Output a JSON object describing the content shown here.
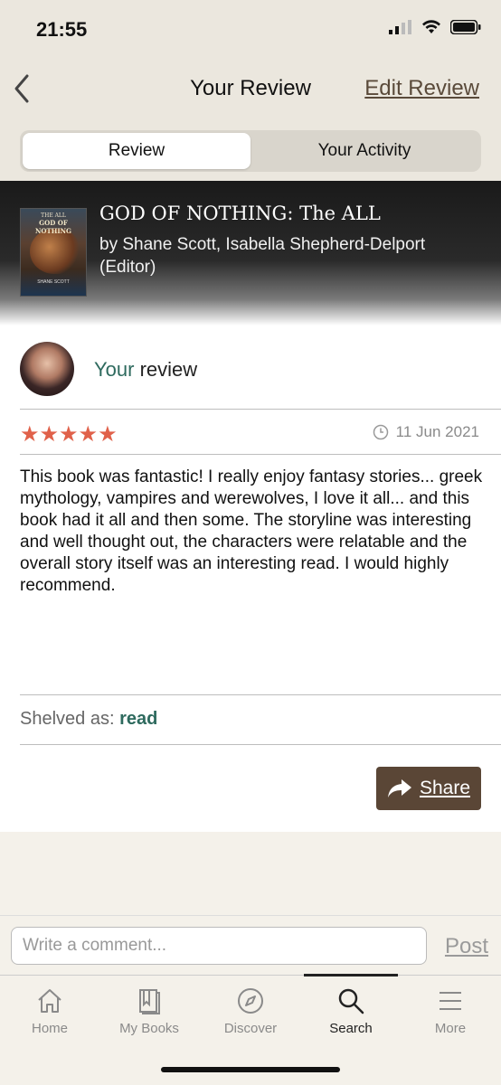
{
  "status_bar": {
    "time": "21:55"
  },
  "nav": {
    "title": "Your Review",
    "edit_label": "Edit Review",
    "tabs": [
      {
        "label": "Review",
        "active": true
      },
      {
        "label": "Your Activity",
        "active": false
      }
    ]
  },
  "book": {
    "title": "GOD OF NOTHING: The ALL",
    "authors": "by Shane Scott, Isabella Shepherd-Delport (Editor)",
    "cover": {
      "top_text": "THE ALL",
      "title": "GOD OF NOTHING",
      "author": "SHANE SCOTT"
    }
  },
  "review": {
    "label_accent": "Your",
    "label_rest": " review",
    "stars": "★★★★★",
    "rating": 5,
    "date": "11 Jun 2021",
    "body": "This book was fantastic! I really enjoy fantasy stories... greek mythology, vampires and werewolves, I love it all... and this book had it all and then some. The storyline was interesting and well thought out, the characters were relatable and the overall story itself was an interesting read. I would highly recommend.",
    "shelved_label": "Shelved as: ",
    "shelf": "read",
    "share_label": "Share"
  },
  "comment": {
    "placeholder": "Write a comment...",
    "post_label": "Post"
  },
  "tab_bar": {
    "items": [
      {
        "label": "Home",
        "icon": "home-icon"
      },
      {
        "label": "My Books",
        "icon": "books-icon"
      },
      {
        "label": "Discover",
        "icon": "compass-icon"
      },
      {
        "label": "Search",
        "icon": "search-icon",
        "active": true
      },
      {
        "label": "More",
        "icon": "menu-icon"
      }
    ]
  },
  "colors": {
    "accent": "#2e6a5e",
    "stars": "#e0614a",
    "share_bg": "#5a4636",
    "background": "#f4f1ea"
  }
}
